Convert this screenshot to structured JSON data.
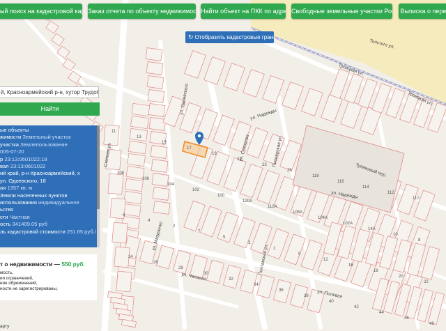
{
  "toolbar": {
    "buttons": [
      "нный поиск на кадастровой карте",
      "Заказ отчета по объекту недвижимости",
      "Найти объект на ПКК по адресу",
      "Свободные земельные участки России",
      "Выписка о перехо"
    ]
  },
  "map": {
    "toggle_borders_label": "Отобразить кадастровые границы",
    "streets": [
      "ул. Одоевского",
      "ул. Надежды",
      "ул. Суворова",
      "Пионерская ул.",
      "Тупиковый пер.",
      "ул. Надежды",
      "ул. Мазуренко",
      "ул. Чапаева",
      "Степная ул.",
      "Полтавская ул.",
      "Толстого ул.",
      "ул. Полевая",
      "Троицкая ул.",
      "Троицкая ул."
    ],
    "parcels": [
      "11",
      "13",
      "15",
      "17",
      "19",
      "21",
      "23",
      "25",
      "118",
      "116",
      "114",
      "112",
      "110",
      "108",
      "106",
      "104",
      "102",
      "100",
      "120А",
      "112А",
      "108А",
      "104А",
      "102А",
      "14А",
      "10",
      "8",
      "6",
      "4",
      "2",
      "7",
      "5",
      "3",
      "1",
      "9",
      "12",
      "16",
      "18",
      "20",
      "22",
      "24",
      "26",
      "28",
      "30",
      "32",
      "34",
      "36",
      "38",
      "40",
      "42",
      "44",
      "46",
      "48"
    ]
  },
  "search": {
    "value": "й, Красноармейский р-н, хутор Трудобелик",
    "find_label": "Найти"
  },
  "info": {
    "rows": [
      {
        "k": "ые объекты",
        "v": ""
      },
      {
        "k": "жимости",
        "v": "Земельный участок"
      },
      {
        "k": "участка",
        "v": "Землепользование"
      },
      {
        "k": "",
        "v": "005-07-20"
      },
      {
        "k": "р",
        "v": "23:13:0601022:18"
      },
      {
        "k": "вал",
        "v": "23:13:0601022"
      },
      {
        "k": "ий край, р-н Красноармейский, х",
        "v": ""
      },
      {
        "k": "ул. Одоевского, 18",
        "v": ""
      },
      {
        "k": "ая",
        "v": "1357 кв. м"
      },
      {
        "k": "Земли населенных пунктов",
        "v": ""
      },
      {
        "k": "использования",
        "v": "индивидуальное"
      },
      {
        "k": "ьство",
        "v": ""
      },
      {
        "k": "сти",
        "v": "Частная"
      },
      {
        "k": "ость",
        "v": "341409.05 руб"
      },
      {
        "k": "ль кадастровой стоимости",
        "v": "251.65 руб./"
      }
    ]
  },
  "order": {
    "title": "т о недвижимости —",
    "price": "550 руб.",
    "lines": [
      "мость,",
      "ии ограничений,",
      "ние обременений,",
      "ности не зарегистрированы,"
    ]
  },
  "edge_note": "арту",
  "colors": {
    "green": "#2fa84f",
    "blue": "#2e6fb8",
    "selected_parcel": "#f7c78a",
    "parcel_border": "#e08a8a"
  }
}
